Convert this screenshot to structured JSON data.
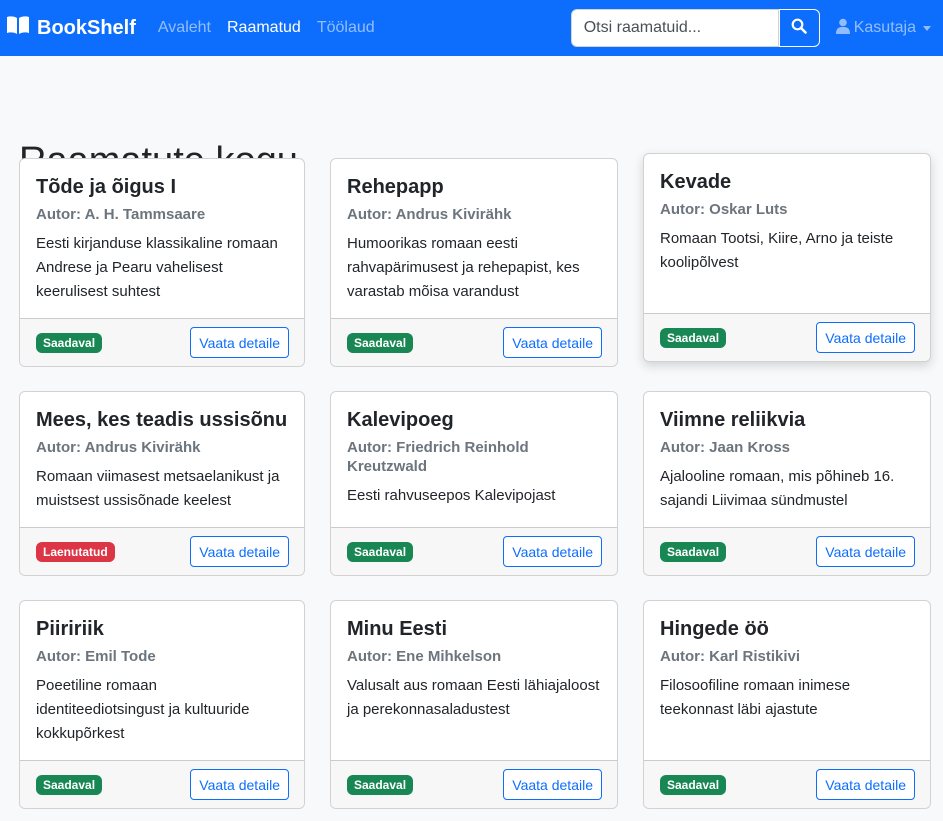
{
  "navbar": {
    "brand": "BookShelf",
    "links": [
      {
        "label": "Avaleht",
        "active": false
      },
      {
        "label": "Raamatud",
        "active": true
      },
      {
        "label": "Töölaud",
        "active": false
      }
    ],
    "search": {
      "placeholder": "Otsi raamatuid...",
      "value": ""
    },
    "user_label": "Kasutaja"
  },
  "page": {
    "title": "Raamatute kogu"
  },
  "books": [
    {
      "title": "Tõde ja õigus I",
      "author": "Autor: A. H. Tammsaare",
      "description": "Eesti kirjanduse klassikaline romaan Andrese ja Pearu vahelisest keerulisest suhtest",
      "status": "Saadaval",
      "button": "Vaata detaile"
    },
    {
      "title": "Rehepapp",
      "author": "Autor: Andrus Kivirähk",
      "description": "Humoorikas romaan eesti rahvapärimusest ja rehepapist, kes varastab mõisa varandust",
      "status": "Saadaval",
      "button": "Vaata detaile"
    },
    {
      "title": "Kevade",
      "author": "Autor: Oskar Luts",
      "description": "Romaan Tootsi, Kiire, Arno ja teiste koolipõlvest",
      "status": "Saadaval",
      "button": "Vaata detaile"
    },
    {
      "title": "Mees, kes teadis ussisõnu",
      "author": "Autor: Andrus Kivirähk",
      "description": "Romaan viimasest metsaelanikust ja muistsest ussisõnade keelest",
      "status": "Laenutatud",
      "button": "Vaata detaile"
    },
    {
      "title": "Kalevipoeg",
      "author": "Autor: Friedrich Reinhold Kreutzwald",
      "description": "Eesti rahvuseepos Kalevipojast",
      "status": "Saadaval",
      "button": "Vaata detaile"
    },
    {
      "title": "Viimne reliikvia",
      "author": "Autor: Jaan Kross",
      "description": "Ajalooline romaan, mis põhineb 16. sajandi Liivimaa sündmustel",
      "status": "Saadaval",
      "button": "Vaata detaile"
    },
    {
      "title": "Piiririik",
      "author": "Autor: Emil Tode",
      "description": "Poeetiline romaan identiteediotsingust ja kultuuride kokkupõrkest",
      "status": "Saadaval",
      "button": "Vaata detaile"
    },
    {
      "title": "Minu Eesti",
      "author": "Autor: Ene Mihkelson",
      "description": "Valusalt aus romaan Eesti lähiajaloost ja perekonnasaladustest",
      "status": "Saadaval",
      "button": "Vaata detaile"
    },
    {
      "title": "Hingede öö",
      "author": "Autor: Karl Ristikivi",
      "description": "Filosoofiline romaan inimese teekonnast läbi ajastute",
      "status": "Saadaval",
      "button": "Vaata detaile"
    }
  ],
  "colors": {
    "primary": "#0d6efd",
    "success": "#198754",
    "danger": "#dc3545"
  }
}
